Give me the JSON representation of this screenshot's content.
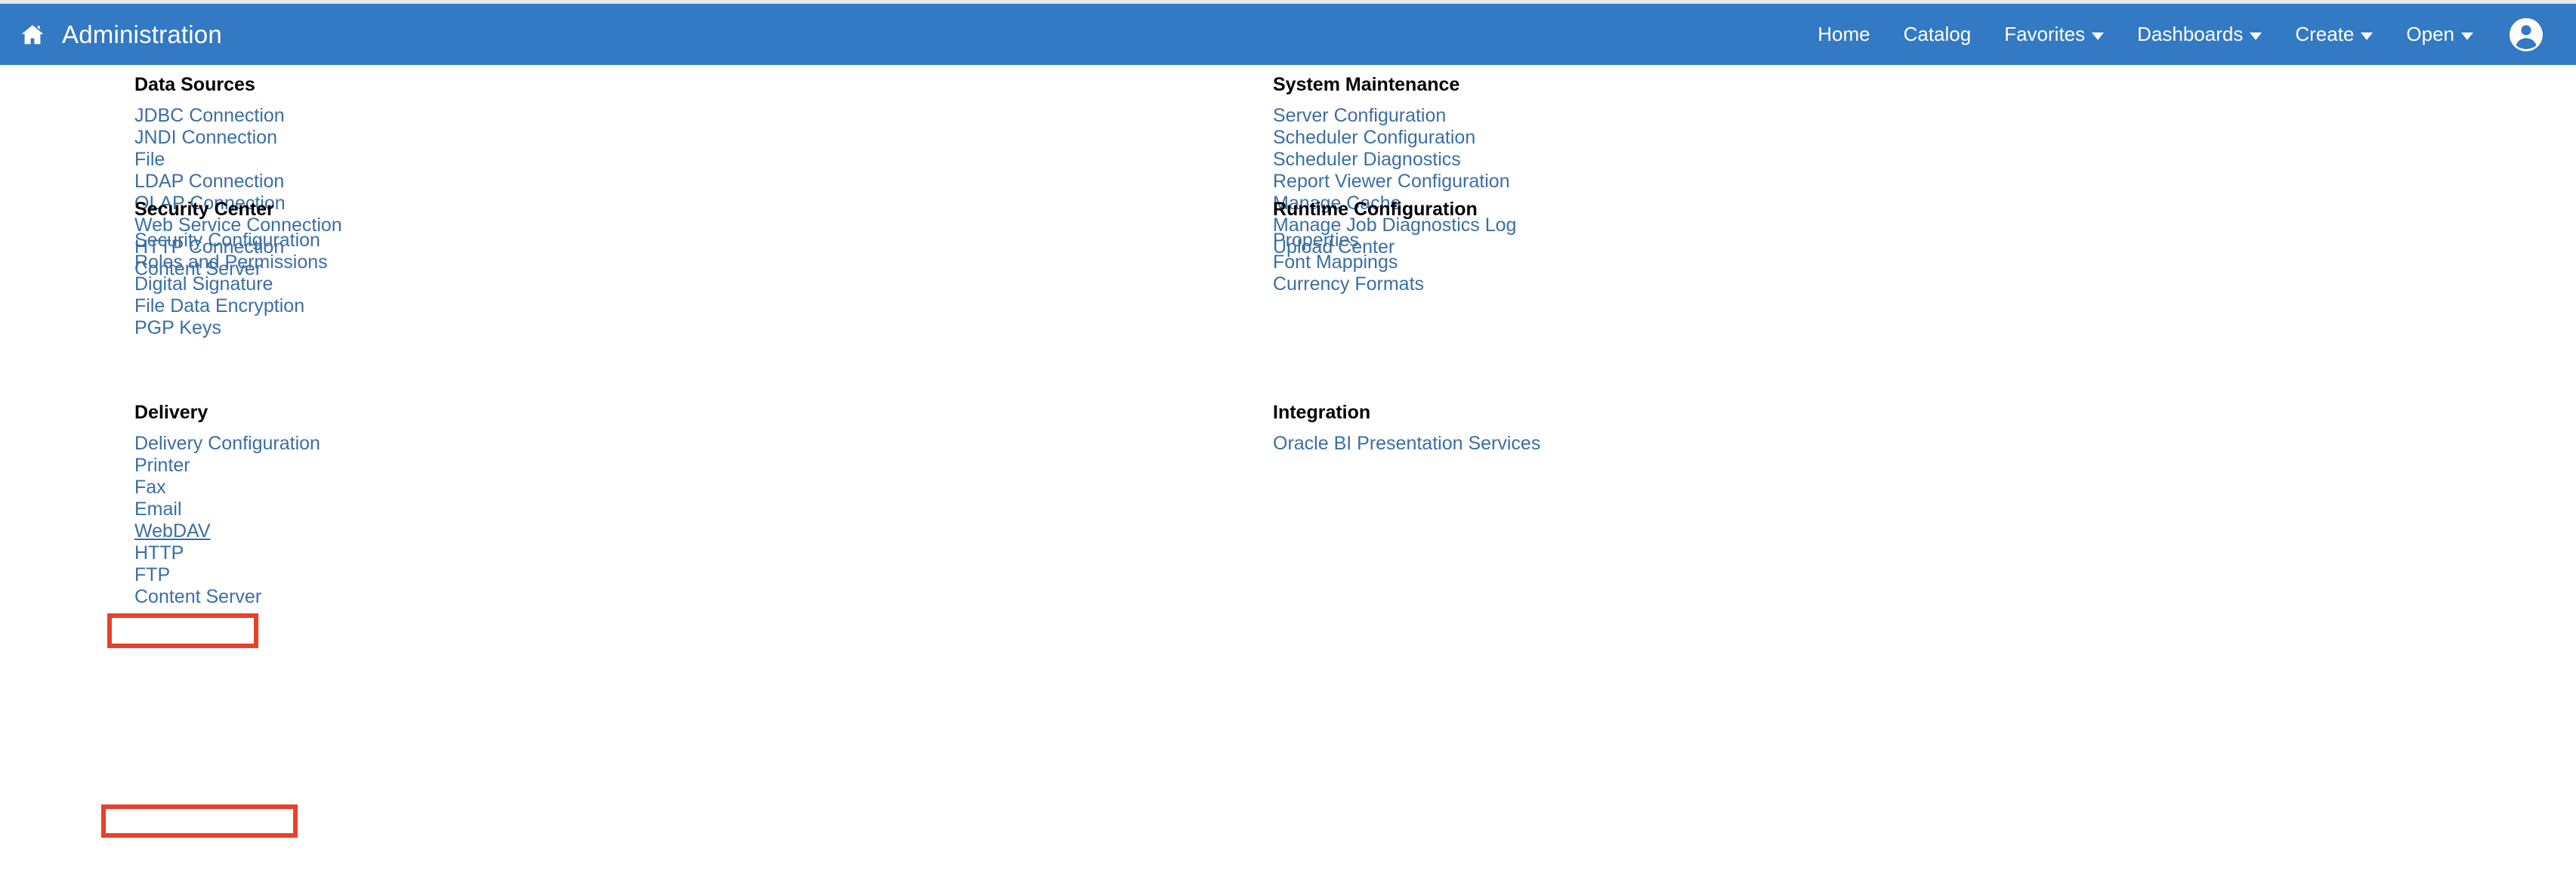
{
  "header": {
    "home_icon": "home-icon",
    "title": "Administration",
    "nav": [
      {
        "label": "Home",
        "has_caret": false
      },
      {
        "label": "Catalog",
        "has_caret": false
      },
      {
        "label": "Favorites",
        "has_caret": true
      },
      {
        "label": "Dashboards",
        "has_caret": true
      },
      {
        "label": "Create",
        "has_caret": true
      },
      {
        "label": "Open",
        "has_caret": true
      }
    ],
    "avatar_icon": "user-avatar-icon",
    "background_color": "#3379c4",
    "text_color": "#ffffff"
  },
  "colors": {
    "header_blue": "#3379c4",
    "link_blue": "#3a6ea5",
    "heading_black": "#000000",
    "annotation_red": "#e8402a",
    "page_background": "#ffffff",
    "top_strip_gray": "#e8e8e8"
  },
  "left_column": [
    {
      "title": "Data Sources",
      "links": [
        "JDBC Connection",
        "JNDI Connection",
        "File",
        "LDAP Connection",
        "OLAP Connection",
        "Web Service Connection",
        "HTTP Connection",
        "Content Server"
      ]
    },
    {
      "title": "Security Center",
      "links": [
        "Security Configuration",
        "Roles and Permissions",
        "Digital Signature",
        "File Data Encryption",
        "PGP Keys"
      ]
    },
    {
      "title": "Delivery",
      "links": [
        "Delivery Configuration",
        "Printer",
        "Fax",
        "Email",
        "WebDAV",
        "HTTP",
        "FTP",
        "Content Server"
      ],
      "hovered_link": "WebDAV"
    }
  ],
  "right_column": [
    {
      "title": "System Maintenance",
      "links": [
        "Server Configuration",
        "Scheduler Configuration",
        "Scheduler Diagnostics",
        "Report Viewer Configuration",
        "Manage Cache",
        "Manage Job Diagnostics Log",
        "Upload Center"
      ]
    },
    {
      "title": "Runtime Configuration",
      "links": [
        "Properties",
        "Font Mappings",
        "Currency Formats"
      ]
    },
    {
      "title": "Integration",
      "links": [
        "Oracle BI Presentation Services"
      ]
    }
  ],
  "annotations": [
    {
      "name": "delivery-heading-highlight",
      "target": "Delivery"
    },
    {
      "name": "content-server-link-highlight",
      "target": "Content Server"
    }
  ]
}
